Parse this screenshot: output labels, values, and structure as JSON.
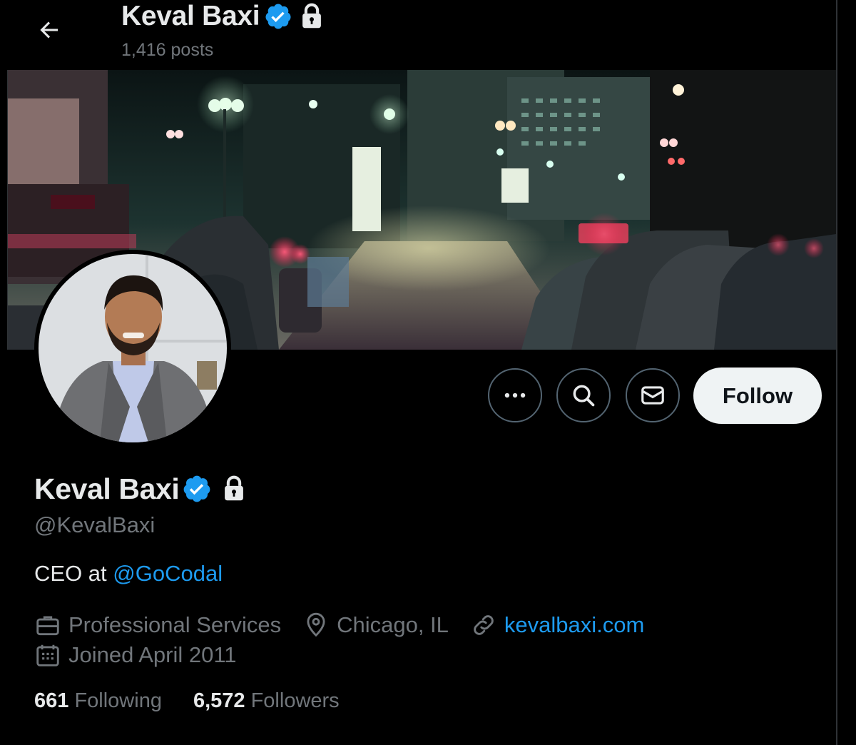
{
  "header": {
    "name": "Keval Baxi",
    "posts": "1,416 posts"
  },
  "profile": {
    "name": "Keval Baxi",
    "handle": "@KevalBaxi",
    "bio_prefix": "CEO at ",
    "bio_mention": "@GoCodal",
    "category": "Professional Services",
    "location": "Chicago, IL",
    "website": "kevalbaxi.com",
    "joined": "Joined April 2011"
  },
  "stats": {
    "following_count": "661",
    "following_label": "Following",
    "followers_count": "6,572",
    "followers_label": "Followers"
  },
  "actions": {
    "follow_label": "Follow"
  },
  "icons": {
    "back": "arrow-left-icon",
    "verified": "verified-badge-icon",
    "protected": "lock-icon",
    "more": "more-horizontal-icon",
    "search": "search-icon",
    "message": "envelope-icon",
    "category": "briefcase-icon",
    "location": "location-pin-icon",
    "website": "link-icon",
    "joined": "calendar-icon"
  },
  "colors": {
    "background": "#000000",
    "text_primary": "#e7e9ea",
    "text_secondary": "#71767b",
    "accent_link": "#1d9bf0",
    "verified": "#1d9bf0",
    "follow_button_bg": "#eff3f4",
    "follow_button_text": "#0f1419"
  }
}
